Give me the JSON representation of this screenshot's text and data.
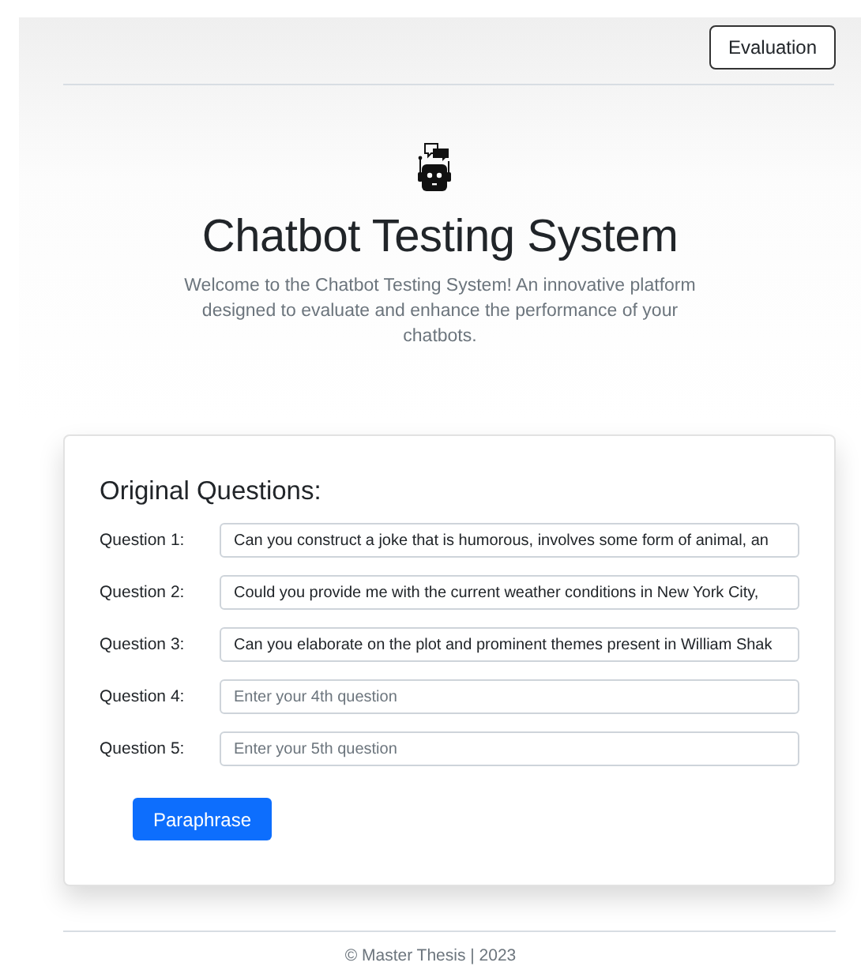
{
  "nav": {
    "button": "Evaluation"
  },
  "hero": {
    "title": "Chatbot Testing System",
    "subtitle": "Welcome to the Chatbot Testing System! An innovative platform designed to evaluate and enhance the performance of your chatbots."
  },
  "form": {
    "heading": "Original Questions:",
    "questions": [
      {
        "label": "Question 1:",
        "value": "Can you construct a joke that is humorous, involves some form of animal, an"
      },
      {
        "label": "Question 2:",
        "value": "Could you provide me with the current weather conditions in New York City,"
      },
      {
        "label": "Question 3:",
        "value": "Can you elaborate on the plot and prominent themes present in William Shak"
      },
      {
        "label": "Question 4:",
        "placeholder": "Enter your 4th question"
      },
      {
        "label": "Question 5:",
        "placeholder": "Enter your 5th question"
      }
    ],
    "button": "Paraphrase"
  },
  "footer": "© Master Thesis | 2023"
}
